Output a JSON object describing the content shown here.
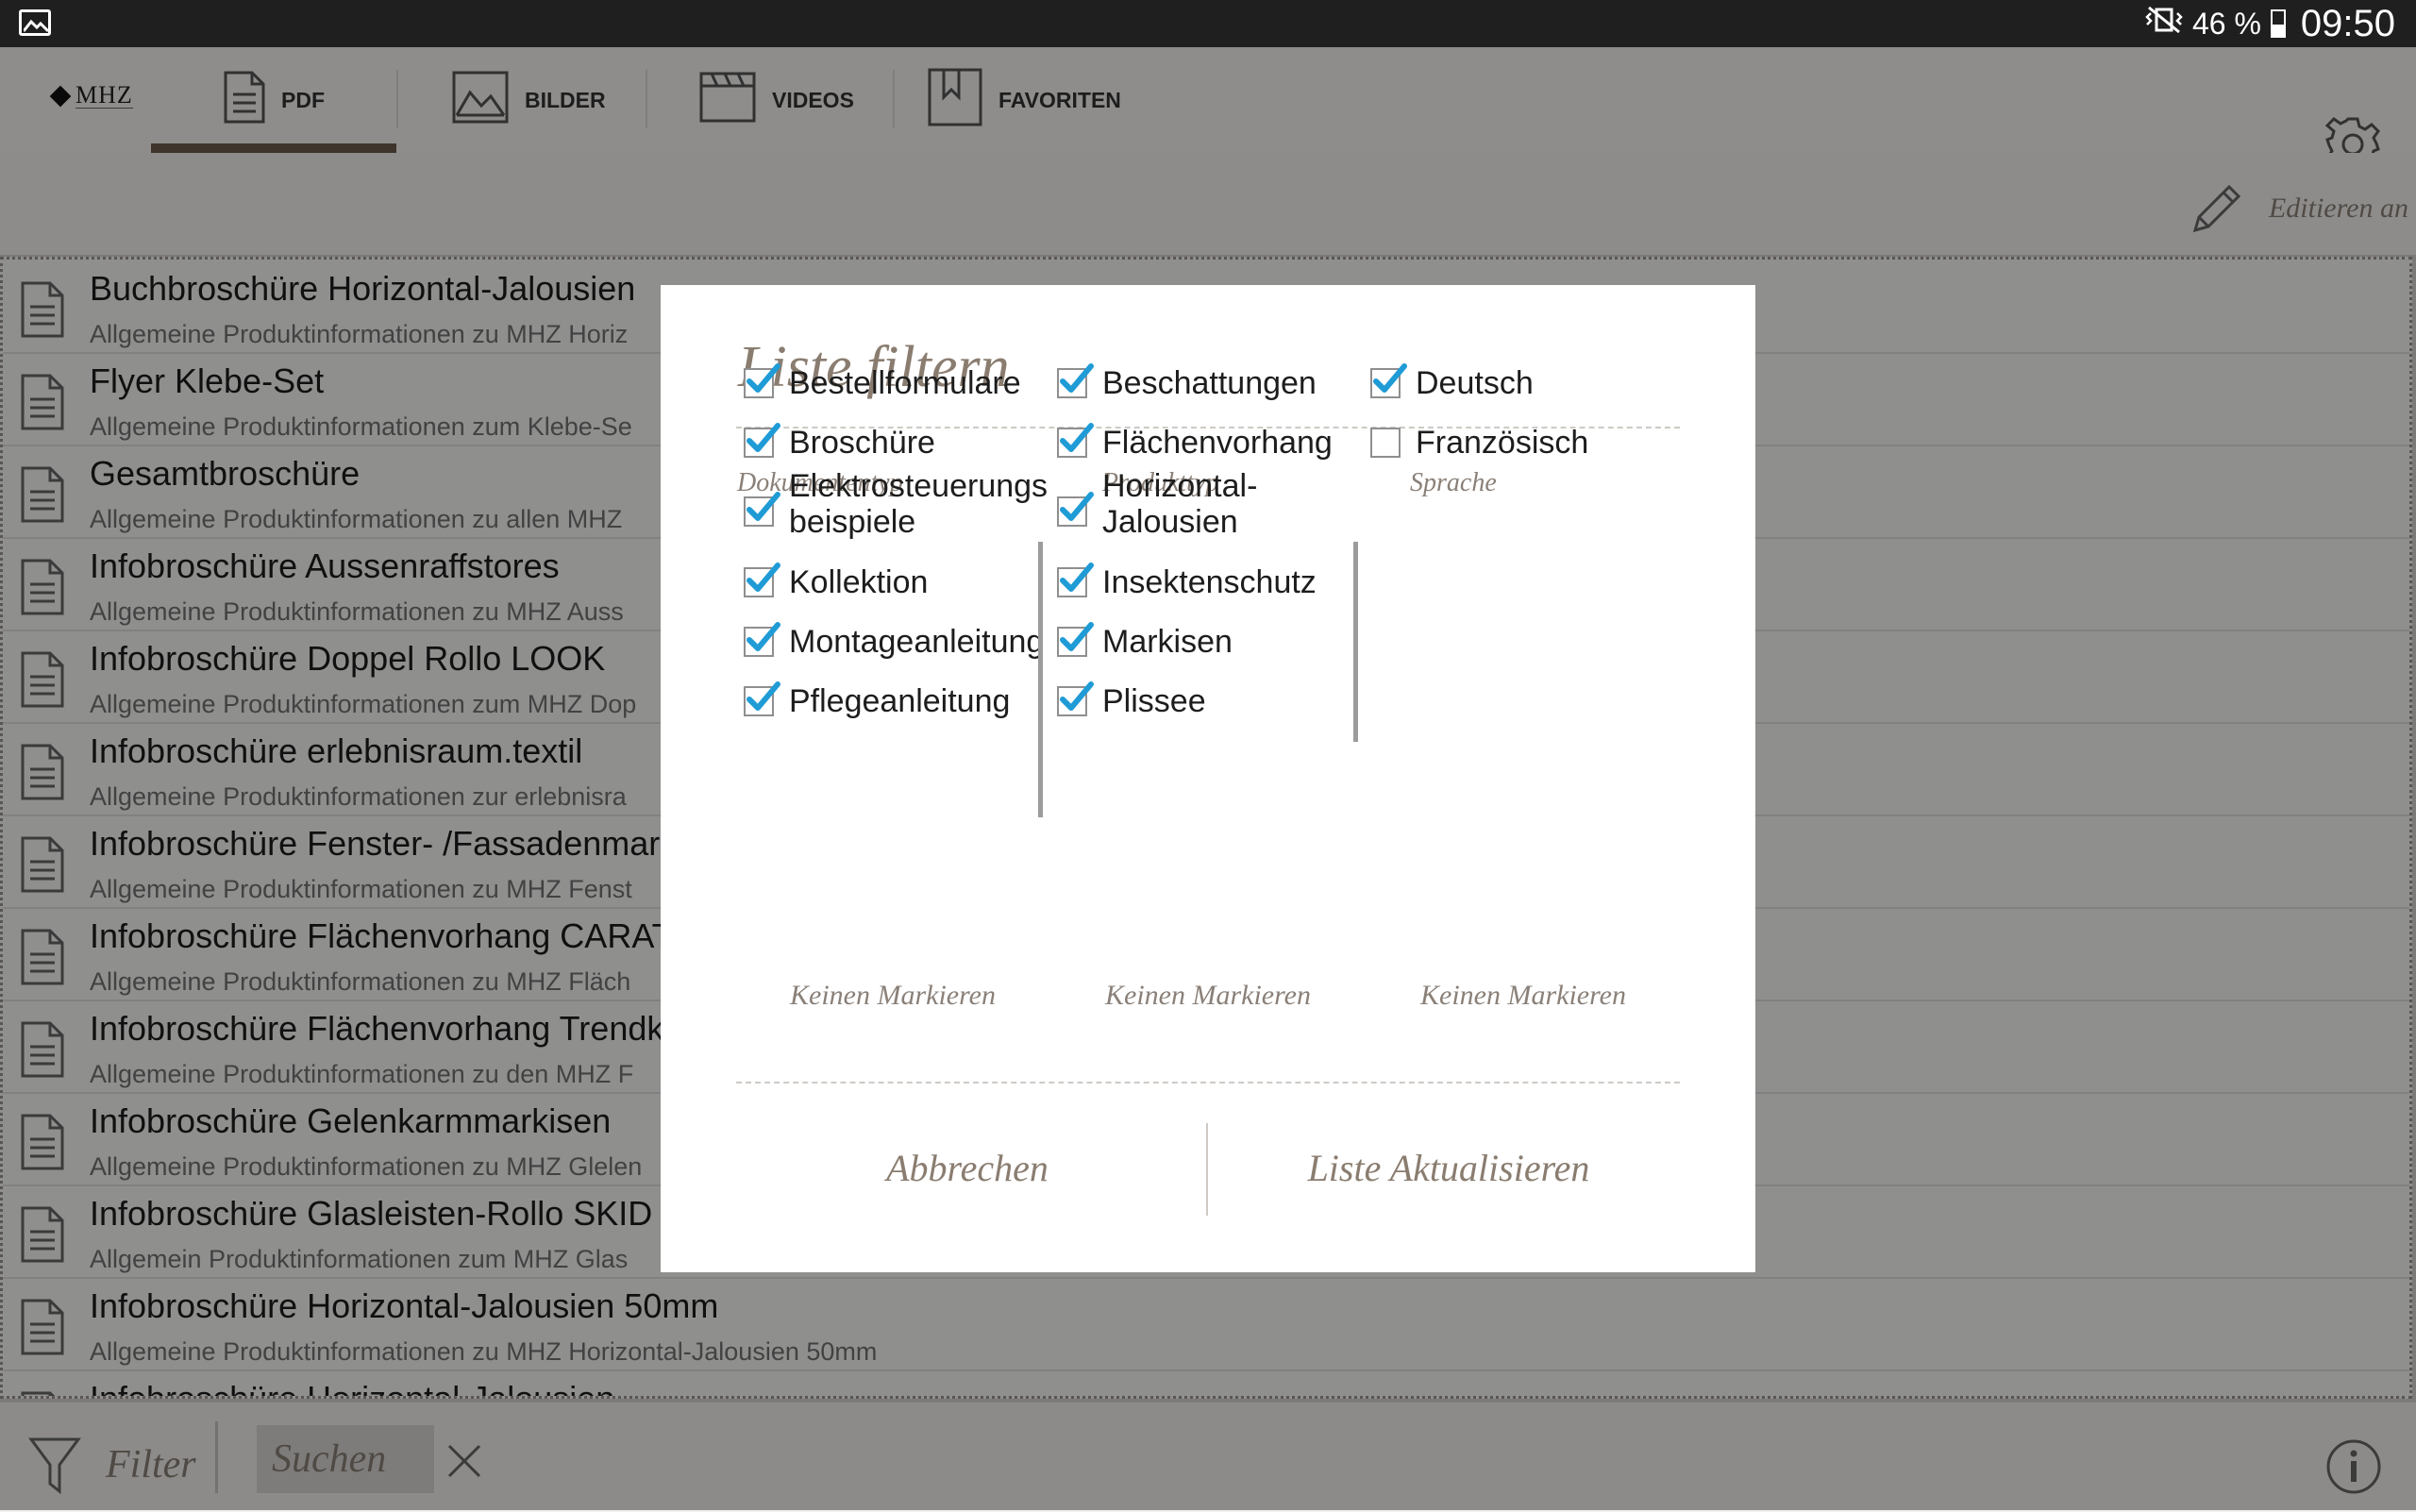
{
  "status_bar": {
    "battery": "46 %",
    "time": "09:50",
    "icons": [
      "gallery-icon",
      "vibrate-icon",
      "battery-icon"
    ]
  },
  "tabbar": {
    "logo": "MHZ",
    "tabs": [
      {
        "label": "PDF",
        "icon": "document-icon",
        "active": true
      },
      {
        "label": "BILDER",
        "icon": "image-icon",
        "active": false
      },
      {
        "label": "VIDEOS",
        "icon": "clapperboard-icon",
        "active": false
      },
      {
        "label": "FAVORITEN",
        "icon": "bookmark-icon",
        "active": false
      }
    ],
    "settings_icon": "gear-icon"
  },
  "edit": {
    "label": "Editieren an",
    "icon": "pencil-icon"
  },
  "list": [
    {
      "title": "Buchbroschüre Horizontal-Jalousien",
      "subtitle": "Allgemeine Produktinformationen zu MHZ Horiz"
    },
    {
      "title": "Flyer Klebe-Set",
      "subtitle": "Allgemeine Produktinformationen zum Klebe-Se"
    },
    {
      "title": "Gesamtbroschüre",
      "subtitle": "Allgemeine Produktinformationen zu allen MHZ"
    },
    {
      "title": "Infobroschüre Aussenraffstores",
      "subtitle": "Allgemeine Produktinformationen zu MHZ Auss"
    },
    {
      "title": "Infobroschüre Doppel Rollo LOOK",
      "subtitle": "Allgemeine Produktinformationen zum MHZ Dop"
    },
    {
      "title": "Infobroschüre erlebnisraum.textil",
      "subtitle": "Allgemeine Produktinformationen zur erlebnisra"
    },
    {
      "title": "Infobroschüre Fenster- /Fassadenmar",
      "subtitle": "Allgemeine Produktinformationen zu MHZ Fenst"
    },
    {
      "title": "Infobroschüre Flächenvorhang CARAT",
      "subtitle": "Allgemeine Produktinformationen zu MHZ Fläch"
    },
    {
      "title": "Infobroschüre Flächenvorhang Trendk",
      "subtitle": "Allgemeine Produktinformationen zu den MHZ F"
    },
    {
      "title": "Infobroschüre Gelenkarmmarkisen",
      "subtitle": "Allgemeine Produktinformationen zu MHZ Glelen"
    },
    {
      "title": "Infobroschüre Glasleisten-Rollo SKID",
      "subtitle": "Allgemein Produktinformationen zum MHZ Glas"
    },
    {
      "title": "Infobroschüre Horizontal-Jalousien 50mm",
      "subtitle": "Allgemeine Produktinformationen zu MHZ Horizontal-Jalousien 50mm"
    },
    {
      "title": "Infobroschüre Horizontal-Jalousien",
      "subtitle": ""
    }
  ],
  "bottom_bar": {
    "filter_label": "Filter",
    "search_placeholder": "Suchen",
    "icons": [
      "funnel-icon",
      "close-icon",
      "info-icon"
    ]
  },
  "dialog": {
    "title": "Liste filtern",
    "columns": [
      {
        "header": "Dokumententyp",
        "none_label": "Keinen Markieren",
        "items": [
          {
            "label": "Bestellformulare",
            "checked": true
          },
          {
            "label": "Broschüre",
            "checked": true
          },
          {
            "label": "Elektrosteuerungs",
            "label2": "beispiele",
            "checked": true
          },
          {
            "label": "Kollektion",
            "checked": true
          },
          {
            "label": "Montageanleitung",
            "checked": true
          },
          {
            "label": "Pflegeanleitung",
            "checked": true
          }
        ]
      },
      {
        "header": "Produkttyp",
        "none_label": "Keinen Markieren",
        "items": [
          {
            "label": "Beschattungen",
            "checked": true
          },
          {
            "label": "Flächenvorhang",
            "checked": true
          },
          {
            "label": "Horizontal-",
            "label2": "Jalousien",
            "checked": true
          },
          {
            "label": "Insektenschutz",
            "checked": true
          },
          {
            "label": "Markisen",
            "checked": true
          },
          {
            "label": "Plissee",
            "checked": true
          }
        ]
      },
      {
        "header": "Sprache",
        "none_label": "Keinen Markieren",
        "items": [
          {
            "label": "Deutsch",
            "checked": true
          },
          {
            "label": "Französisch",
            "checked": false
          }
        ]
      }
    ],
    "cancel_label": "Abbrechen",
    "apply_label": "Liste Aktualisieren"
  },
  "colors": {
    "accent_brown": "#6b5a4c",
    "serif_text": "#8a7d70",
    "checkbox_blue": "#1f9bd6"
  }
}
